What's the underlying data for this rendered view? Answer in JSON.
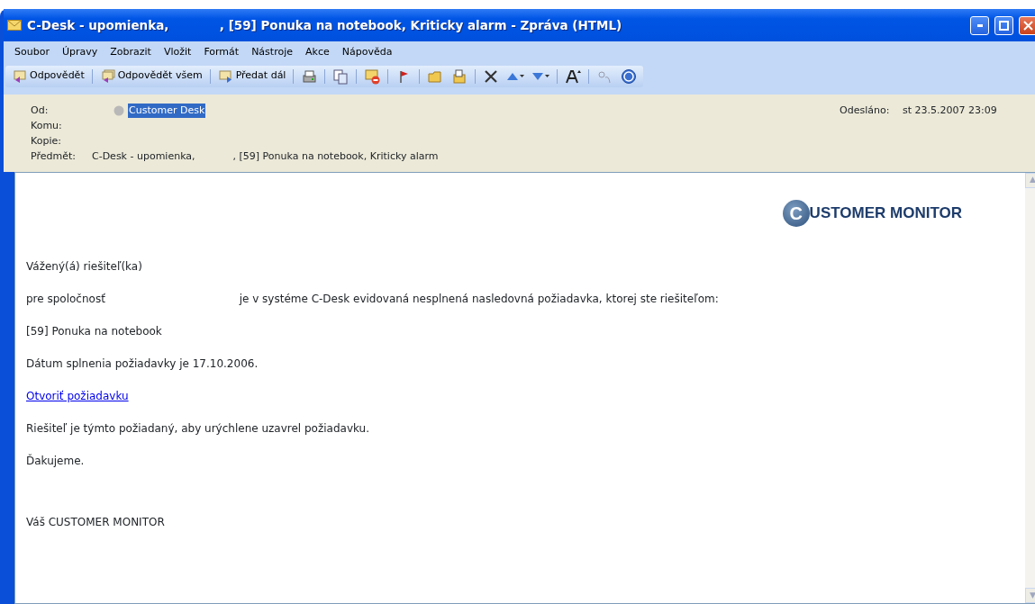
{
  "window": {
    "title": "C-Desk - upomienka,            , [59] Ponuka na notebook, Kriticky alarm - Zpráva (HTML)"
  },
  "menu": [
    "Soubor",
    "Úpravy",
    "Zobrazit",
    "Vložit",
    "Formát",
    "Nástroje",
    "Akce",
    "Nápověda"
  ],
  "toolbar": [
    {
      "kind": "text",
      "label": "Odpovědět"
    },
    {
      "kind": "text",
      "label": "Odpovědět všem"
    },
    {
      "kind": "text",
      "label": "Předat dál"
    }
  ],
  "scroll_arrows": [
    "▲",
    "▼"
  ],
  "header": {
    "from_label": "Od:",
    "from": "Customer Desk",
    "to_label": "Komu:",
    "cc_label": "Kopie:",
    "subject_label": "Předmět:",
    "subject": "C-Desk - upomienka,            , [59] Ponuka na notebook, Kriticky alarm",
    "sent_label": "Odesláno:",
    "sent": "st 23.5.2007 23:09"
  },
  "message": {
    "logo_letter": "C",
    "logo_text": "USTOMER MONITOR",
    "paragraphs": [
      {
        "kind": "text",
        "text": "Vážený(á) riešiteľ(ka)"
      },
      {
        "kind": "text",
        "text": "pre spoločnosť                                       je v systéme C-Desk evidovaná nesplnená nasledovná požiadavka, ktorej ste riešiteľom:"
      },
      {
        "kind": "text",
        "text": "[59] Ponuka na notebook"
      },
      {
        "kind": "text",
        "text": "Dátum splnenia požiadavky je 17.10.2006."
      },
      {
        "kind": "link",
        "text": "Otvoriť požiadavku"
      },
      {
        "kind": "text",
        "text": "Riešiteľ je týmto požiadaný, aby urýchlene uzavrel požiadavku."
      },
      {
        "kind": "text",
        "text": "Ďakujeme."
      },
      {
        "kind": "gap"
      },
      {
        "kind": "text",
        "text": "Váš CUSTOMER MONITOR"
      }
    ]
  }
}
